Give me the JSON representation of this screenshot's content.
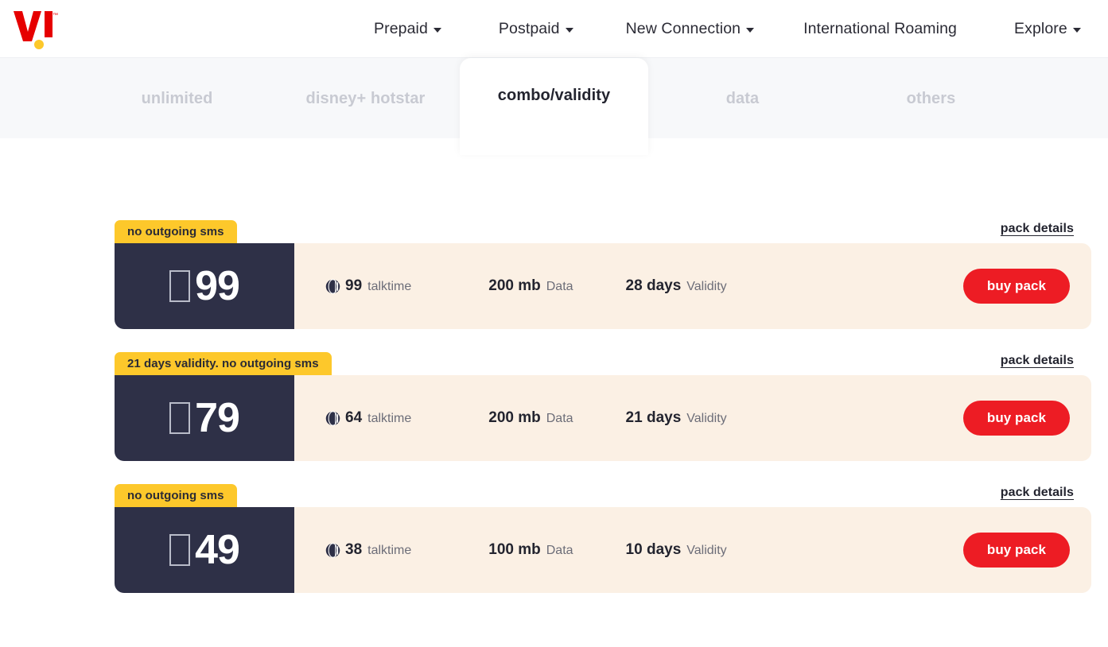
{
  "brand": {
    "logo_text": "VI",
    "logo_mark": "vi-logo",
    "red": "#ed1c24",
    "yellow": "#fdc82b",
    "navy": "#2e3047",
    "cream": "#fbf0e4"
  },
  "nav": {
    "items": [
      {
        "label": "Prepaid",
        "has_caret": true
      },
      {
        "label": "Postpaid",
        "has_caret": true
      },
      {
        "label": "New Connection",
        "has_caret": true
      },
      {
        "label": "International Roaming",
        "has_caret": false
      },
      {
        "label": "Explore",
        "has_caret": true
      }
    ]
  },
  "tabs": {
    "items": [
      {
        "label": "unlimited",
        "active": false
      },
      {
        "label": "disney+ hotstar",
        "active": false
      },
      {
        "label": "combo/validity",
        "active": true
      },
      {
        "label": "data",
        "active": false
      },
      {
        "label": "others",
        "active": false
      }
    ]
  },
  "labels": {
    "pack_details": "pack details",
    "buy_pack": "buy pack",
    "talktime": "talktime",
    "data": "Data",
    "validity": "Validity",
    "currency_glyph": "₹"
  },
  "plans": [
    {
      "badge": "no outgoing sms",
      "price": "99",
      "talktime_value": "99",
      "talktime_label": "talktime",
      "data_value": "200 mb",
      "data_label": "Data",
      "validity_value": "28 days",
      "validity_label": "Validity",
      "pack_details": "pack details",
      "buy_pack": "buy pack"
    },
    {
      "badge": "21 days validity. no outgoing sms",
      "price": "79",
      "talktime_value": "64",
      "talktime_label": "talktime",
      "data_value": "200 mb",
      "data_label": "Data",
      "validity_value": "21 days",
      "validity_label": "Validity",
      "pack_details": "pack details",
      "buy_pack": "buy pack"
    },
    {
      "badge": "no outgoing sms",
      "price": "49",
      "talktime_value": "38",
      "talktime_label": "talktime",
      "data_value": "100 mb",
      "data_label": "Data",
      "validity_value": "10 days",
      "validity_label": "Validity",
      "pack_details": "pack details",
      "buy_pack": "buy pack"
    }
  ]
}
